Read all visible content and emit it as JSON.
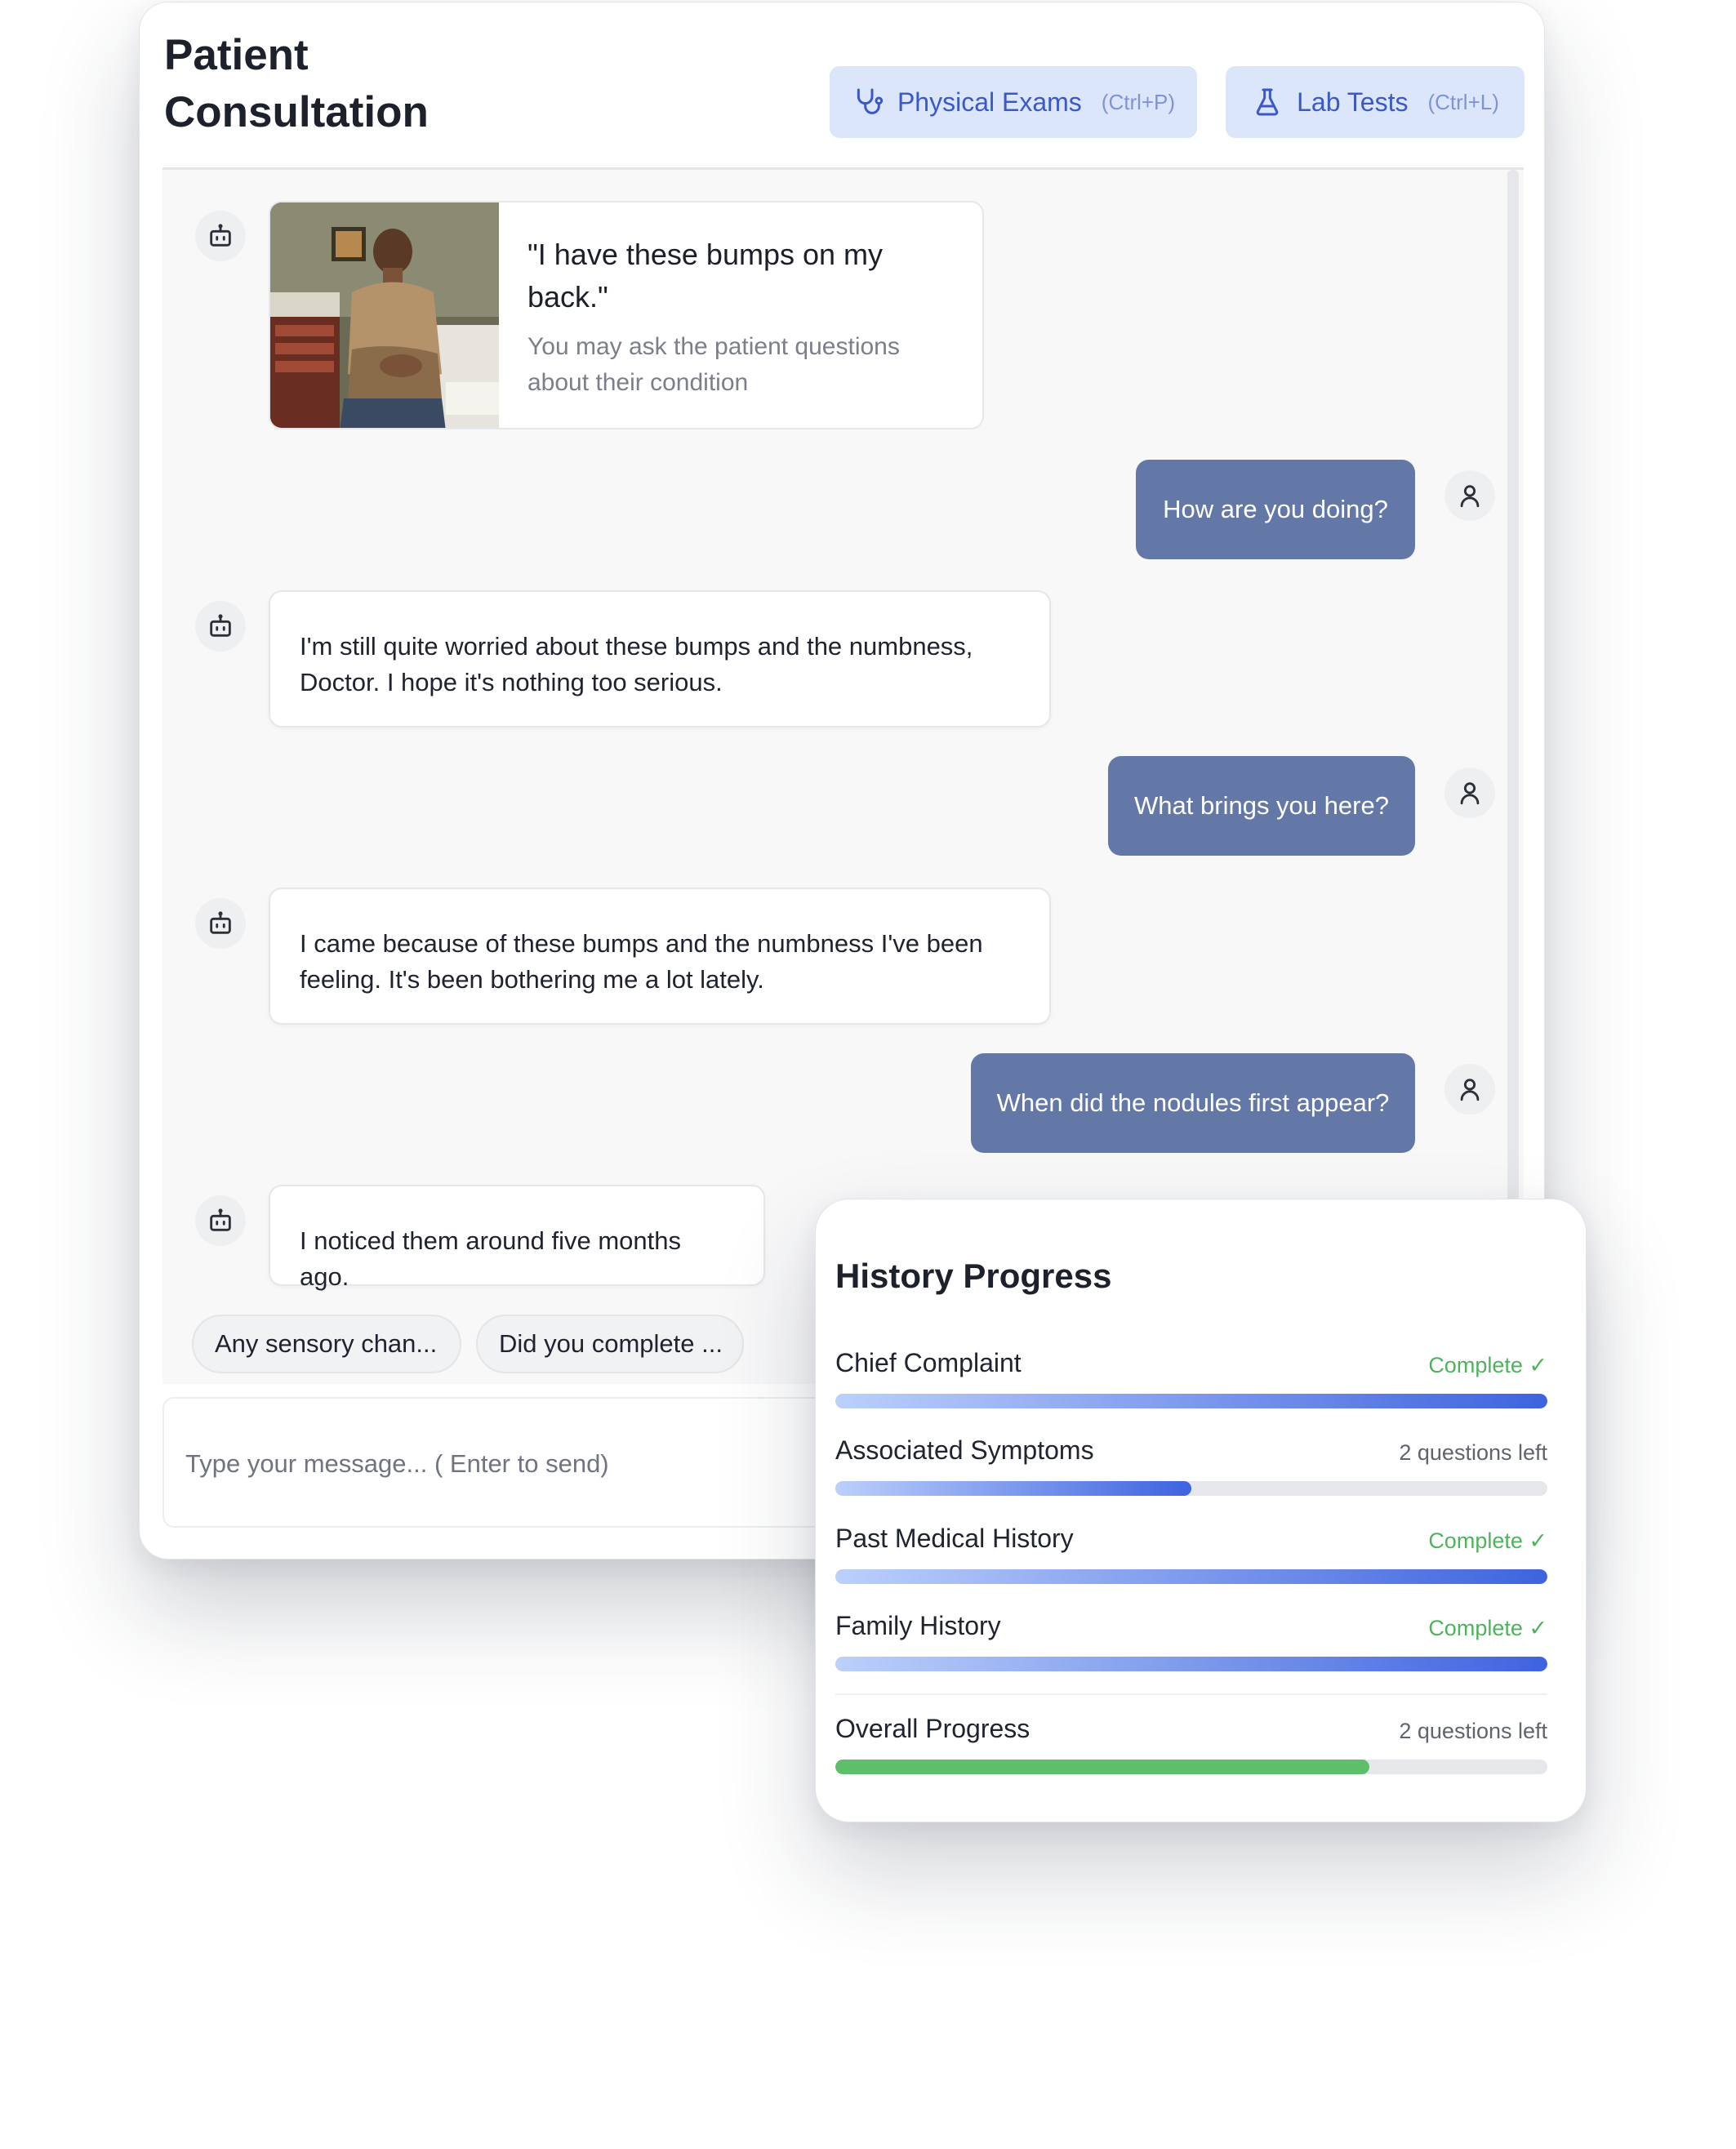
{
  "header": {
    "title": "Patient Consultation",
    "physical_exams": {
      "label": "Physical Exams",
      "shortcut": "(Ctrl+P)",
      "icon": "stethoscope-icon"
    },
    "lab_tests": {
      "label": "Lab Tests",
      "shortcut": "(Ctrl+L)",
      "icon": "flask-icon"
    }
  },
  "chat": {
    "intro": {
      "quote": "\"I have these bumps on my back.\"",
      "hint": "You may ask the patient questions about their condition"
    },
    "messages": [
      {
        "role": "doctor",
        "text": "How are you doing?"
      },
      {
        "role": "patient",
        "text": "I'm still quite worried about these bumps and the numbness, Doctor. I hope it's nothing too serious."
      },
      {
        "role": "doctor",
        "text": "What brings you here?"
      },
      {
        "role": "patient",
        "text": "I came because of these bumps and the numbness I've been feeling. It's been bothering me a lot lately."
      },
      {
        "role": "doctor",
        "text": "When did the nodules first appear?"
      },
      {
        "role": "patient",
        "text": "I noticed them around five months ago."
      }
    ],
    "suggestions": [
      "Any sensory chan...",
      "Did you complete ..."
    ],
    "input_placeholder": "Type your message... ( Enter to send)"
  },
  "progress": {
    "title": "History Progress",
    "items": [
      {
        "name": "Chief Complaint",
        "status": "Complete ✓",
        "fraction": 1.0,
        "complete": true
      },
      {
        "name": "Associated Symptoms",
        "status": "2 questions left",
        "fraction": 0.5,
        "complete": false
      },
      {
        "name": "Past Medical History",
        "status": "Complete ✓",
        "fraction": 1.0,
        "complete": true
      },
      {
        "name": "Family History",
        "status": "Complete ✓",
        "fraction": 1.0,
        "complete": true
      }
    ],
    "overall": {
      "name": "Overall Progress",
      "status": "2 questions left",
      "fraction": 0.75
    }
  },
  "colors": {
    "accent": "#3b58c9",
    "doctor_bubble": "#6478a8",
    "complete_green": "#4fb35d",
    "button_bg": "#dbe6fb"
  }
}
